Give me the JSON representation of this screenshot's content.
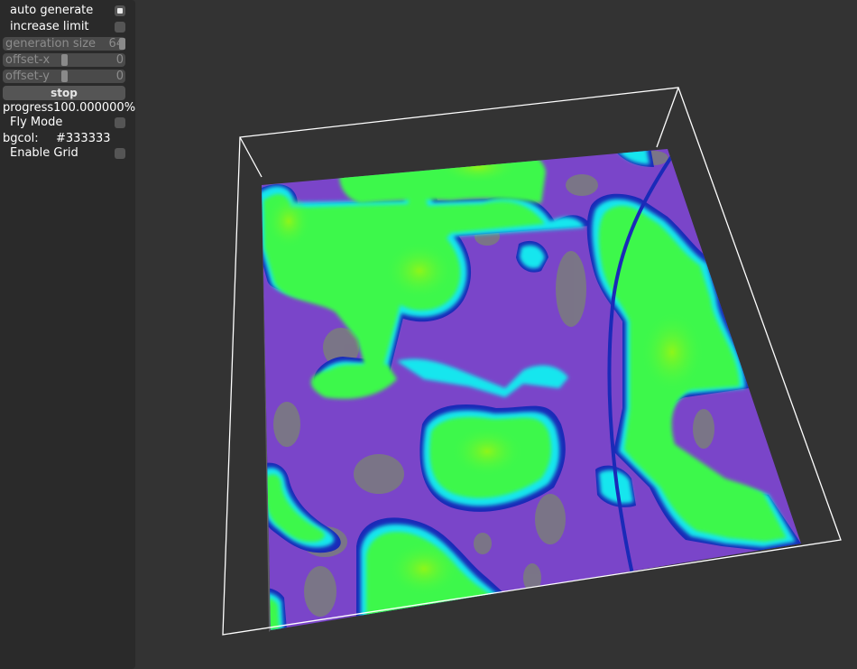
{
  "panel": {
    "auto_generate": {
      "label": "auto generate",
      "checked": true
    },
    "increase_limit": {
      "label": "increase limit",
      "checked": false
    },
    "generation_size": {
      "label": "generation size",
      "value": "64"
    },
    "offset_x": {
      "label": "offset-x",
      "value": "0"
    },
    "offset_y": {
      "label": "offset-y",
      "value": "0"
    },
    "stop_button": {
      "label": "stop"
    },
    "progress": {
      "label": "progress",
      "value": "100.000000%"
    },
    "fly_mode": {
      "label": "Fly Mode",
      "checked": false
    },
    "bgcol": {
      "label": "bgcol:",
      "value": "#333333"
    },
    "enable_grid": {
      "label": "Enable Grid",
      "checked": false
    }
  },
  "scene": {
    "background": "#333333",
    "colors": {
      "violet": "#7a45c9",
      "grey_patch": "#7a7a80",
      "navy": "#1a2ab8",
      "cyan": "#16e6ee",
      "green": "#3cf84c",
      "lime": "#88f51a",
      "box": "#ffffff"
    }
  }
}
